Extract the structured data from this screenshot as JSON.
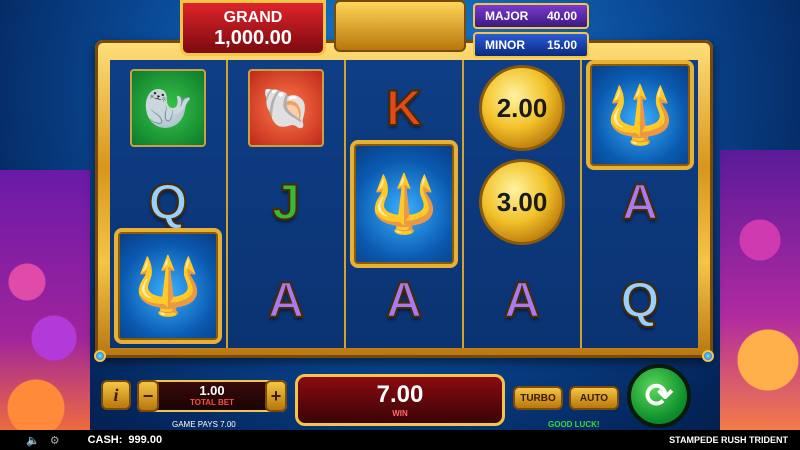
{
  "jackpots": {
    "grand_label": "GRAND",
    "grand_value": "1,000.00",
    "major_label": "MAJOR",
    "major_value": "40.00",
    "minor_label": "MINOR",
    "minor_value": "15.00"
  },
  "reels": [
    [
      {
        "kind": "tile",
        "name": "seahorse-symbol",
        "color": "green",
        "glyph": "🦭"
      },
      {
        "kind": "letter",
        "text": "Q",
        "cls": "l-q"
      },
      {
        "kind": "trident-bottom"
      }
    ],
    [
      {
        "kind": "tile",
        "name": "conch-shell-symbol",
        "color": "red",
        "glyph": "🐚"
      },
      {
        "kind": "letter",
        "text": "J",
        "cls": "l-j"
      },
      {
        "kind": "letter",
        "text": "A",
        "cls": "l-a"
      }
    ],
    [
      {
        "kind": "letter",
        "text": "K",
        "cls": "l-k"
      },
      {
        "kind": "trident-middle"
      },
      {
        "kind": "letter",
        "text": "A",
        "cls": "l-a"
      }
    ],
    [
      {
        "kind": "coin",
        "text": "2.00"
      },
      {
        "kind": "coin",
        "text": "3.00"
      },
      {
        "kind": "letter",
        "text": "A",
        "cls": "l-a"
      }
    ],
    [
      {
        "kind": "trident-top"
      },
      {
        "kind": "letter",
        "text": "A",
        "cls": "l-a"
      },
      {
        "kind": "letter",
        "text": "Q",
        "cls": "l-q"
      }
    ]
  ],
  "controls": {
    "info_label": "i",
    "minus_label": "−",
    "plus_label": "+",
    "bet_value": "1.00",
    "bet_label": "TOTAL BET",
    "win_value": "7.00",
    "win_label": "WIN",
    "turbo_label": "TURBO",
    "auto_label": "AUTO",
    "spin_glyph": "⟳"
  },
  "messages": {
    "game_pays": "GAME PAYS 7.00",
    "good_luck": "GOOD LUCK!"
  },
  "statusbar": {
    "cash_label": "CASH:",
    "cash_value": "999.00",
    "game_title": "STAMPEDE RUSH TRIDENT"
  },
  "colors": {
    "gold": "#f5c545",
    "red_panel": "#8a0a10",
    "spin_green": "#0a8a2a",
    "good_luck_green": "#3ad83a"
  }
}
